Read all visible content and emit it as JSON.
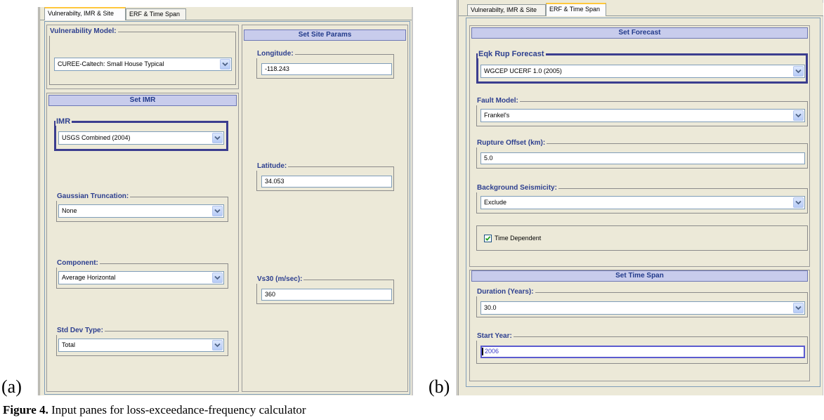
{
  "panel_a": {
    "label": "(a)",
    "tabs": [
      {
        "label": "Vulnerabilty, IMR & Site",
        "active": true
      },
      {
        "label": "ERF & Time Span",
        "active": false
      }
    ],
    "vulnerability": {
      "legend": "Vulnerability Model:",
      "value": "CUREE-Caltech: Small House Typical"
    },
    "imr_section": {
      "header": "Set IMR",
      "imr": {
        "legend": "IMR",
        "value": "USGS Combined (2004)"
      },
      "gaussian": {
        "legend": "Gaussian Truncation:",
        "value": "None"
      },
      "component": {
        "legend": "Component:",
        "value": "Average Horizontal"
      },
      "std_dev": {
        "legend": "Std Dev Type:",
        "value": "Total"
      }
    },
    "site_section": {
      "header": "Set Site Params",
      "longitude": {
        "legend": "Longitude:",
        "value": "-118.243"
      },
      "latitude": {
        "legend": "Latitude:",
        "value": "34.053"
      },
      "vs30": {
        "legend": "Vs30 (m/sec):",
        "value": "360"
      }
    }
  },
  "panel_b": {
    "label": "(b)",
    "tabs": [
      {
        "label": "Vulnerabilty, IMR & Site",
        "active": false
      },
      {
        "label": "ERF & Time Span",
        "active": true
      }
    ],
    "forecast": {
      "header": "Set Forecast",
      "eqk": {
        "legend": "Eqk Rup Forecast",
        "value": "WGCEP UCERF 1.0 (2005)"
      },
      "fault_model": {
        "legend": "Fault Model:",
        "value": "Frankel's"
      },
      "rupture_offset": {
        "legend": "Rupture Offset (km):",
        "value": "5.0"
      },
      "background": {
        "legend": "Background Seismicity:",
        "value": "Exclude"
      },
      "time_dependent": {
        "label": "Time Dependent",
        "checked": true
      }
    },
    "time_span": {
      "header": "Set Time Span",
      "duration": {
        "legend": "Duration (Years):",
        "value": "30.0"
      },
      "start_year": {
        "legend": "Start Year:",
        "value": "2006"
      }
    }
  },
  "caption": {
    "figure": "Figure 4.",
    "text": " Input panes for loss-exceedance-frequency calculator"
  },
  "colors": {
    "panel_bg": "#ece9d8",
    "header_bg": "#c8ccec",
    "legend_text": "#2d3f8f",
    "highlight_border": "#3b3d8f",
    "active_tab_accent": "#ffc83c"
  }
}
